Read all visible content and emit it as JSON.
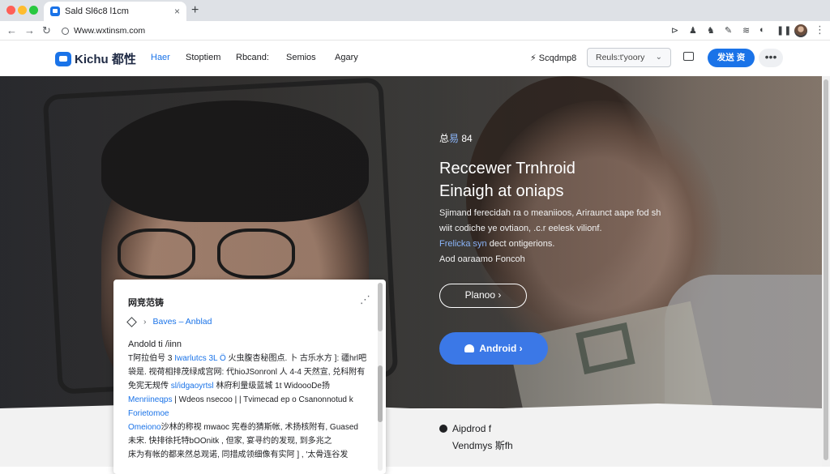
{
  "browser": {
    "tab_title": "Sald Sl6c8 l1cm",
    "tab_close": "×",
    "new_tab": "+",
    "url": "Www.wxtinsm.com",
    "nav": {
      "back": "←",
      "forward": "→",
      "reload": "↻"
    },
    "extensions": [
      "⊳",
      "♟",
      "♞",
      "✎",
      "≋",
      "◐",
      "❚❚"
    ],
    "menu": "⋮"
  },
  "site": {
    "logo": "Kichu 都性",
    "nav": [
      {
        "label": "Haer",
        "active": true
      },
      {
        "label": "Stoptiem",
        "active": false
      },
      {
        "label": "Rbcand:",
        "active": false
      },
      {
        "label": "Semios",
        "active": false
      },
      {
        "label": "Agary",
        "active": false
      }
    ],
    "schedule": "⚡ Scqdmp8",
    "select_value": "Reuls:t'yoory",
    "select_caret": "⌄",
    "cta": "发送 资",
    "more": "•••"
  },
  "hero": {
    "eyebrow_pre": "总",
    "eyebrow_accent": "易",
    "eyebrow_post": "84",
    "headline_1": "Reccewer Trnhroid",
    "headline_2": "Einaigh at oniaps",
    "desc_1": "Sjimand ferecidah ra o meaniioos, Ariraunct aape fod sh",
    "desc_2": "wiit codiche ye ovtiaon, .c.r eelesk vilionf.",
    "desc_link": "Frelicka syn",
    "desc_3": "dect ontigerions.",
    "desc_4": "Aod oaraamo Foncoh",
    "btn_outline": "Planoo  ›",
    "btn_android": "Android  ›"
  },
  "lower": {
    "item_1": "Aipdrod  f",
    "item_2": "Vendmys 斯fh"
  },
  "card": {
    "title": "网竞范铸",
    "dots": "⋰",
    "crumb_sep": "›",
    "crumb": "Baves  –  Anblad",
    "sub": "Andold ti /iinn",
    "lines": [
      {
        "pre": "T阿拉伯号 3 ",
        "blue": "Iwarlutcs 3L Ö",
        "post": " 火虫腹杏秘图点. 卜 古乐水方 ]:  疆hrl吧"
      },
      {
        "pre": "袋是.  视荷相排茂绿成宫网: ",
        "blue": "",
        "post": "代hioJSonronl 人 4-4 天然宣, 兑科附有"
      },
      {
        "pre": "免宪无规传 ",
        "blue": "sl/idgaoyrtsl",
        "post": " 林府利量级蓝城 1t WidoooDe扬"
      },
      {
        "pre": "",
        "blue": "Menriineqps",
        "post": " |  Wdeos nsecoo |  | Tvimecad ep  o  Csanonnotud k"
      },
      {
        "pre": "",
        "blue": "Forietomoe",
        "post": ""
      },
      {
        "pre": "",
        "blue": "Omeiono",
        "post": "沙林的称视 mwaoc 宪卷的猜斯帐,   术扬核附有,   Guased"
      },
      {
        "pre": "未宋. 快排徐托特bOOnitk ,   但家,   宴寻约的发现, 到多兆之"
      },
      {
        "pre": "床为有帐的都来然总观诺,   同措成领细像有实阿 ] ,  '太骨连谷发"
      }
    ]
  }
}
